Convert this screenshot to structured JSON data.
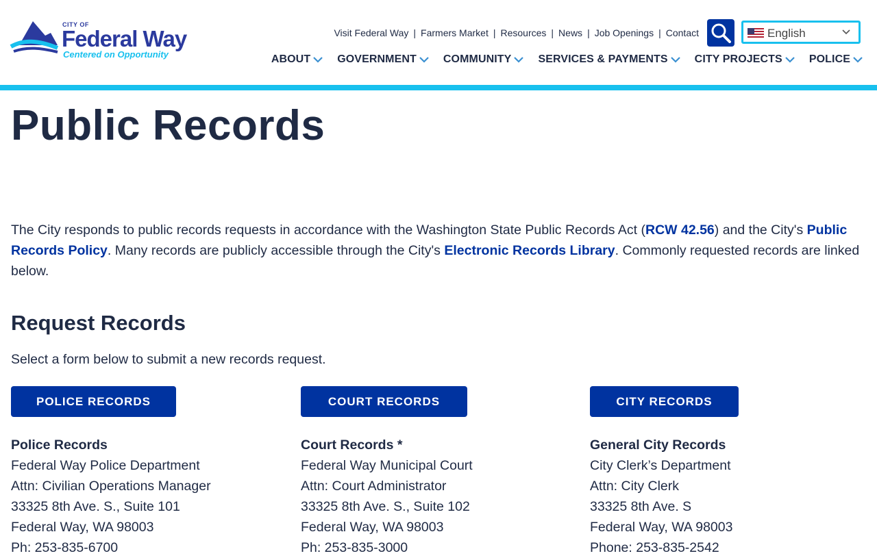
{
  "colors": {
    "brand_navy": "#1f2a44",
    "brand_blue": "#0033a0",
    "logo_blue": "#2b3a9e",
    "logo_cyan": "#18c0ee",
    "accent_bar": "#18c0ee",
    "search_bg": "#0033a0"
  },
  "logo": {
    "city_of": "CITY OF",
    "name": "Federal Way",
    "tagline": "Centered on Opportunity"
  },
  "utility_nav": [
    "Visit Federal Way",
    "Farmers Market",
    "Resources",
    "News",
    "Job Openings",
    "Contact"
  ],
  "utility_separator": "|",
  "language": {
    "selected": "English",
    "flag_icon": "us-flag-icon"
  },
  "main_nav": [
    "ABOUT",
    "GOVERNMENT",
    "COMMUNITY",
    "SERVICES & PAYMENTS",
    "CITY PROJECTS",
    "POLICE"
  ],
  "page": {
    "title": "Public Records",
    "intro": {
      "p1": "The City responds to public records requests in accordance with the Washington State Public Records Act (",
      "link_rcw": "RCW 42.56",
      "p2": ") and the City's ",
      "link_policy": "Public Records Policy",
      "p3": ". Many records are publicly accessible through the City's ",
      "link_library": "Electronic Records Library",
      "p4": ". Commonly requested records are linked below."
    },
    "request_heading": "Request Records",
    "request_text": "Select a form below to submit a new records request."
  },
  "cards": [
    {
      "button": "POLICE RECORDS",
      "heading": "Police Records",
      "lines": [
        "Federal Way Police Department",
        "Attn: Civilian Operations Manager",
        "33325 8th Ave. S., Suite 101",
        "Federal Way, WA 98003",
        "Ph: 253-835-6700"
      ]
    },
    {
      "button": "COURT RECORDS",
      "heading": "Court Records *",
      "lines": [
        "Federal Way Municipal Court",
        "Attn: Court Administrator",
        "33325 8th Ave. S., Suite 102",
        "Federal Way, WA 98003",
        "Ph: 253-835-3000"
      ]
    },
    {
      "button": "CITY RECORDS",
      "heading": "General City Records",
      "lines": [
        "City Clerk’s Department",
        "Attn: City Clerk",
        "33325 8th Ave. S",
        "Federal Way, WA 98003",
        "Phone: 253-835-2542"
      ]
    }
  ]
}
